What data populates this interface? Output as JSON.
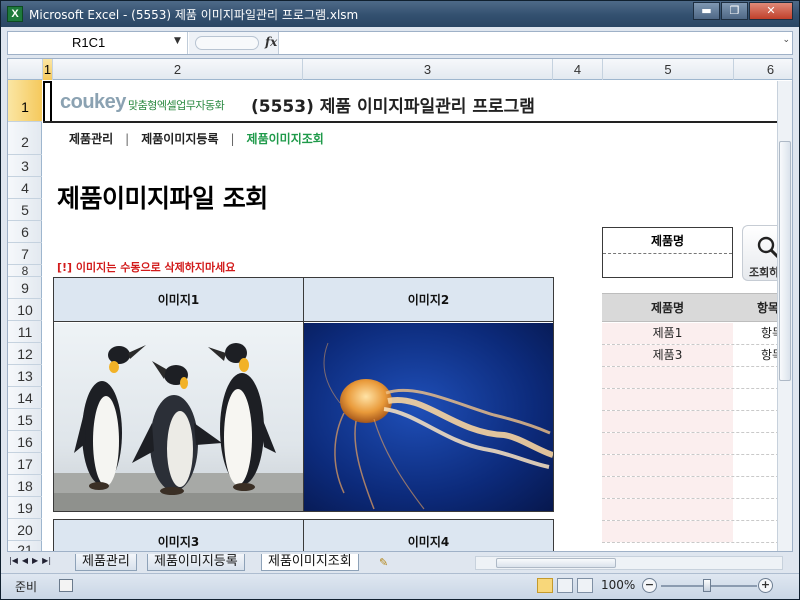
{
  "window": {
    "title": "Microsoft Excel - (5553) 제품 이미지파일관리 프로그램.xlsm",
    "app_icon": "X",
    "minimize": "▬",
    "maximize": "❐",
    "close": "✕"
  },
  "formula_bar": {
    "name_box": "R1C1",
    "fx": "fx",
    "value": ""
  },
  "columns": [
    "1",
    "2",
    "3",
    "4",
    "5",
    "6"
  ],
  "rows": [
    "1",
    "2",
    "3",
    "4",
    "5",
    "6",
    "7",
    "8",
    "9",
    "10",
    "11",
    "12",
    "13",
    "14",
    "15",
    "16",
    "17",
    "18",
    "19",
    "20",
    "21"
  ],
  "brand": {
    "name": "coukey",
    "tagline": "맞춤형엑셀업무자동화"
  },
  "program_title": "(5553) 제품 이미지파일관리 프로그램",
  "nav": {
    "items": [
      "제품관리",
      "제품이미지등록",
      "제품이미지조회"
    ],
    "separator": "|",
    "active_index": 2
  },
  "page_heading": "제품이미지파일 조회",
  "warning": "[!] 이미지는 수동으로 삭제하지마세요",
  "images": [
    {
      "label": "이미지1",
      "subject": "penguins"
    },
    {
      "label": "이미지2",
      "subject": "jellyfish"
    },
    {
      "label": "이미지3",
      "subject": ""
    },
    {
      "label": "이미지4",
      "subject": ""
    }
  ],
  "search": {
    "label": "제품명",
    "value": "",
    "button_label": "조회하",
    "button_icon": "magnifier-icon"
  },
  "result_table": {
    "headers": [
      "제품명",
      "항목"
    ],
    "rows": [
      [
        "제품1",
        "항목"
      ],
      [
        "제품3",
        "항목"
      ]
    ],
    "empty_rows": 8
  },
  "sheet_tabs": [
    "제품관리",
    "제품이미지등록",
    "제품이미지조회"
  ],
  "active_tab": 2,
  "status": {
    "text": "준비",
    "zoom": "100%"
  },
  "colors": {
    "accent_green": "#1f9a4a",
    "warning_red": "#d21b1b",
    "header_fill": "#dce6f1",
    "selection_yellow": "#f5c95c"
  }
}
